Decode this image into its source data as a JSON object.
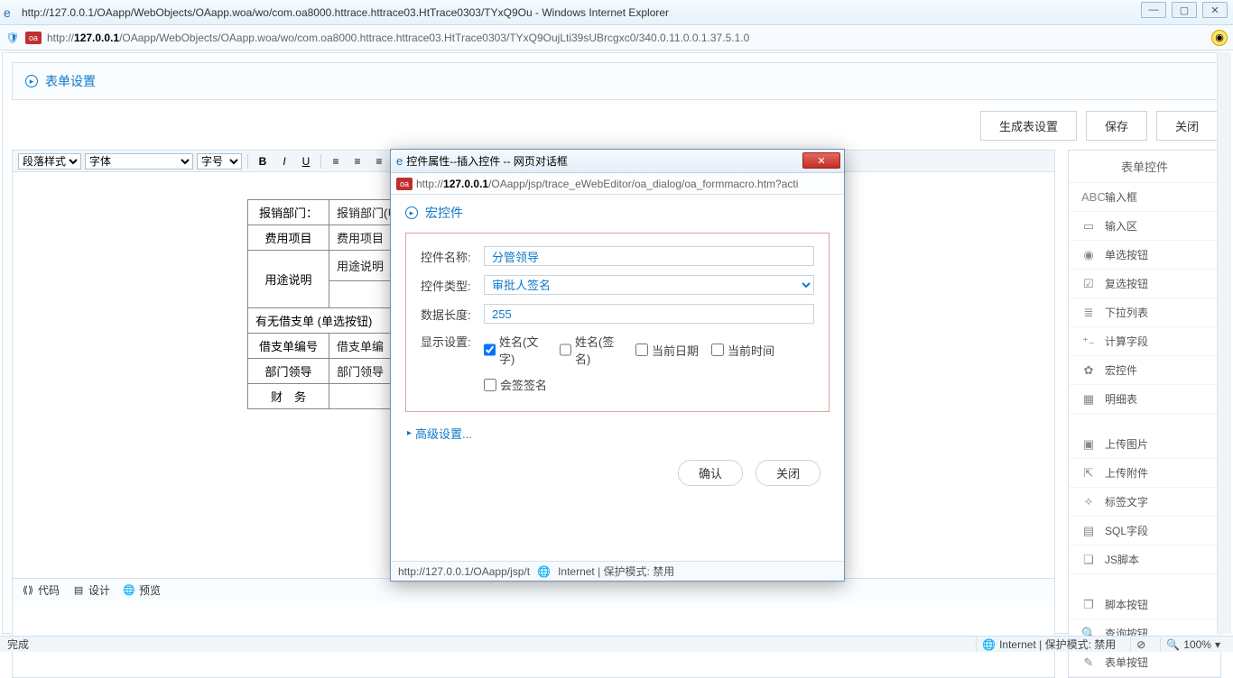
{
  "window": {
    "title_url": "http://127.0.0.1/OAapp/WebObjects/OAapp.woa/wo/com.oa8000.httrace.httrace03.HtTrace0303/TYxQ9Ou",
    "title_app": " - Windows Internet Explorer",
    "addr_prefix": "http://",
    "addr_host": "127.0.0.1",
    "addr_rest": "/OAapp/WebObjects/OAapp.woa/wo/com.oa8000.httrace.httrace03.HtTrace0303/TYxQ9OujLti39sUBrcgxc0/340.0.11.0.0.1.37.5.1.0"
  },
  "page_header": "表单设置",
  "buttons": {
    "generate": "生成表设置",
    "save": "保存",
    "close": "关闭"
  },
  "toolbar": {
    "para_style": "段落样式",
    "font": "字体",
    "size": "字号"
  },
  "form_rows": {
    "r1_lbl": "报销部门：",
    "r1_val": "报销部门(申请",
    "r2_lbl": "费用项目",
    "r2_val": "费用项目",
    "r3_lbl": "用途说明",
    "r3_val": "用途说明",
    "section": "有无借支单 (单选按钮)",
    "r4_lbl": "借支单编号",
    "r4_val": "借支单编",
    "r5_lbl": "部门领导",
    "r5_val": "部门领导",
    "r6_lbl": "财　务",
    "r6_val": ""
  },
  "view_tabs": {
    "code": "代码",
    "design": "设计",
    "preview": "预览"
  },
  "palette": {
    "title": "表单控件",
    "items": [
      {
        "icon": "ABC",
        "label": "输入框"
      },
      {
        "icon": "▭",
        "label": "输入区"
      },
      {
        "icon": "◉",
        "label": "单选按钮"
      },
      {
        "icon": "☑",
        "label": "复选按钮"
      },
      {
        "icon": "≣",
        "label": "下拉列表"
      },
      {
        "icon": "⁺₋",
        "label": "计算字段"
      },
      {
        "icon": "✿",
        "label": "宏控件"
      },
      {
        "icon": "▦",
        "label": "明细表"
      }
    ],
    "items2": [
      {
        "icon": "▣",
        "label": "上传图片"
      },
      {
        "icon": "⇱",
        "label": "上传附件"
      },
      {
        "icon": "✧",
        "label": "标签文字"
      },
      {
        "icon": "▤",
        "label": "SQL字段"
      },
      {
        "icon": "❏",
        "label": "JS脚本"
      }
    ],
    "items3": [
      {
        "icon": "❐",
        "label": "脚本按钮"
      },
      {
        "icon": "🔍",
        "label": "查询按钮"
      },
      {
        "icon": "✎",
        "label": "表单按钮"
      }
    ]
  },
  "dialog": {
    "title": "控件属性--插入控件 -- 网页对话框",
    "addr_prefix": "http://",
    "addr_host": "127.0.0.1",
    "addr_rest": "/OAapp/jsp/trace_eWebEditor/oa_dialog/oa_formmacro.htm?acti",
    "panel_title": "宏控件",
    "fields": {
      "name_lbl": "控件名称:",
      "name_val": "分管领导",
      "type_lbl": "控件类型:",
      "type_val": "审批人签名",
      "len_lbl": "数据长度:",
      "len_val": "255",
      "disp_lbl": "显示设置:",
      "chk1": "姓名(文字)",
      "chk2": "姓名(签名)",
      "chk3": "当前日期",
      "chk4": "当前时间",
      "chk5": "会签签名"
    },
    "adv": "高级设置...",
    "ok": "确认",
    "cancel": "关闭",
    "status_path": "http://127.0.0.1/OAapp/jsp/t",
    "status_zone": "Internet | 保护模式: 禁用"
  },
  "statusbar": {
    "done": "完成",
    "zone": "Internet | 保护模式: 禁用",
    "zoom": "100%"
  }
}
